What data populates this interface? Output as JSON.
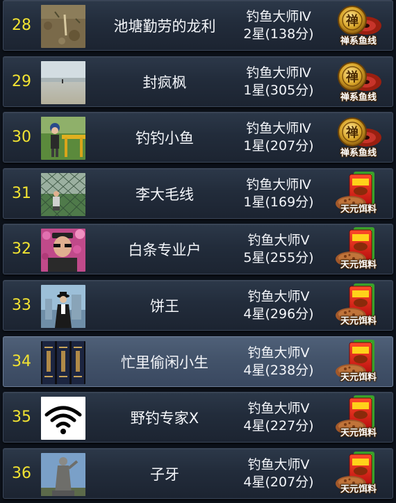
{
  "rows": [
    {
      "rank": "28",
      "name": "池塘勤劳的龙利",
      "title": "钓鱼大师Ⅳ",
      "stars": "2星(138分)",
      "reward": "禅系鱼线",
      "avatar": "dirt-ground-photo",
      "reward_icon": "fishing-line-reel-icon"
    },
    {
      "rank": "29",
      "name": "封疯枫",
      "title": "钓鱼大师Ⅳ",
      "stars": "1星(305分)",
      "reward": "禅系鱼线",
      "avatar": "beach-photo",
      "reward_icon": "fishing-line-reel-icon"
    },
    {
      "rank": "30",
      "name": "钓钓小鱼",
      "title": "钓鱼大师Ⅳ",
      "stars": "1星(207分)",
      "reward": "禅系鱼线",
      "avatar": "child-playground-photo",
      "reward_icon": "fishing-line-reel-icon"
    },
    {
      "rank": "31",
      "name": "李大毛线",
      "title": "钓鱼大师Ⅳ",
      "stars": "1星(169分)",
      "reward": "天元饵料",
      "avatar": "fence-person-photo",
      "reward_icon": "bait-pack-icon"
    },
    {
      "rank": "32",
      "name": "白条专业户",
      "title": "钓鱼大师Ⅴ",
      "stars": "5星(255分)",
      "reward": "天元饵料",
      "avatar": "man-flowers-photo",
      "reward_icon": "bait-pack-icon"
    },
    {
      "rank": "33",
      "name": "饼王",
      "title": "钓鱼大师Ⅴ",
      "stars": "4星(296分)",
      "reward": "天元饵料",
      "avatar": "suited-figure-photo",
      "reward_icon": "bait-pack-icon"
    },
    {
      "rank": "34",
      "name": "忙里偷闲小生",
      "title": "钓鱼大师Ⅴ",
      "stars": "4星(238分)",
      "reward": "天元饵料",
      "avatar": "book-spines-photo",
      "reward_icon": "bait-pack-icon",
      "highlighted": true
    },
    {
      "rank": "35",
      "name": "野钓专家X",
      "title": "钓鱼大师Ⅴ",
      "stars": "4星(227分)",
      "reward": "天元饵料",
      "avatar": "wifi-icon",
      "reward_icon": "bait-pack-icon"
    },
    {
      "rank": "36",
      "name": "子牙",
      "title": "钓鱼大师Ⅴ",
      "stars": "4星(207分)",
      "reward": "天元饵料",
      "avatar": "statue-photo",
      "reward_icon": "bait-pack-icon"
    }
  ]
}
